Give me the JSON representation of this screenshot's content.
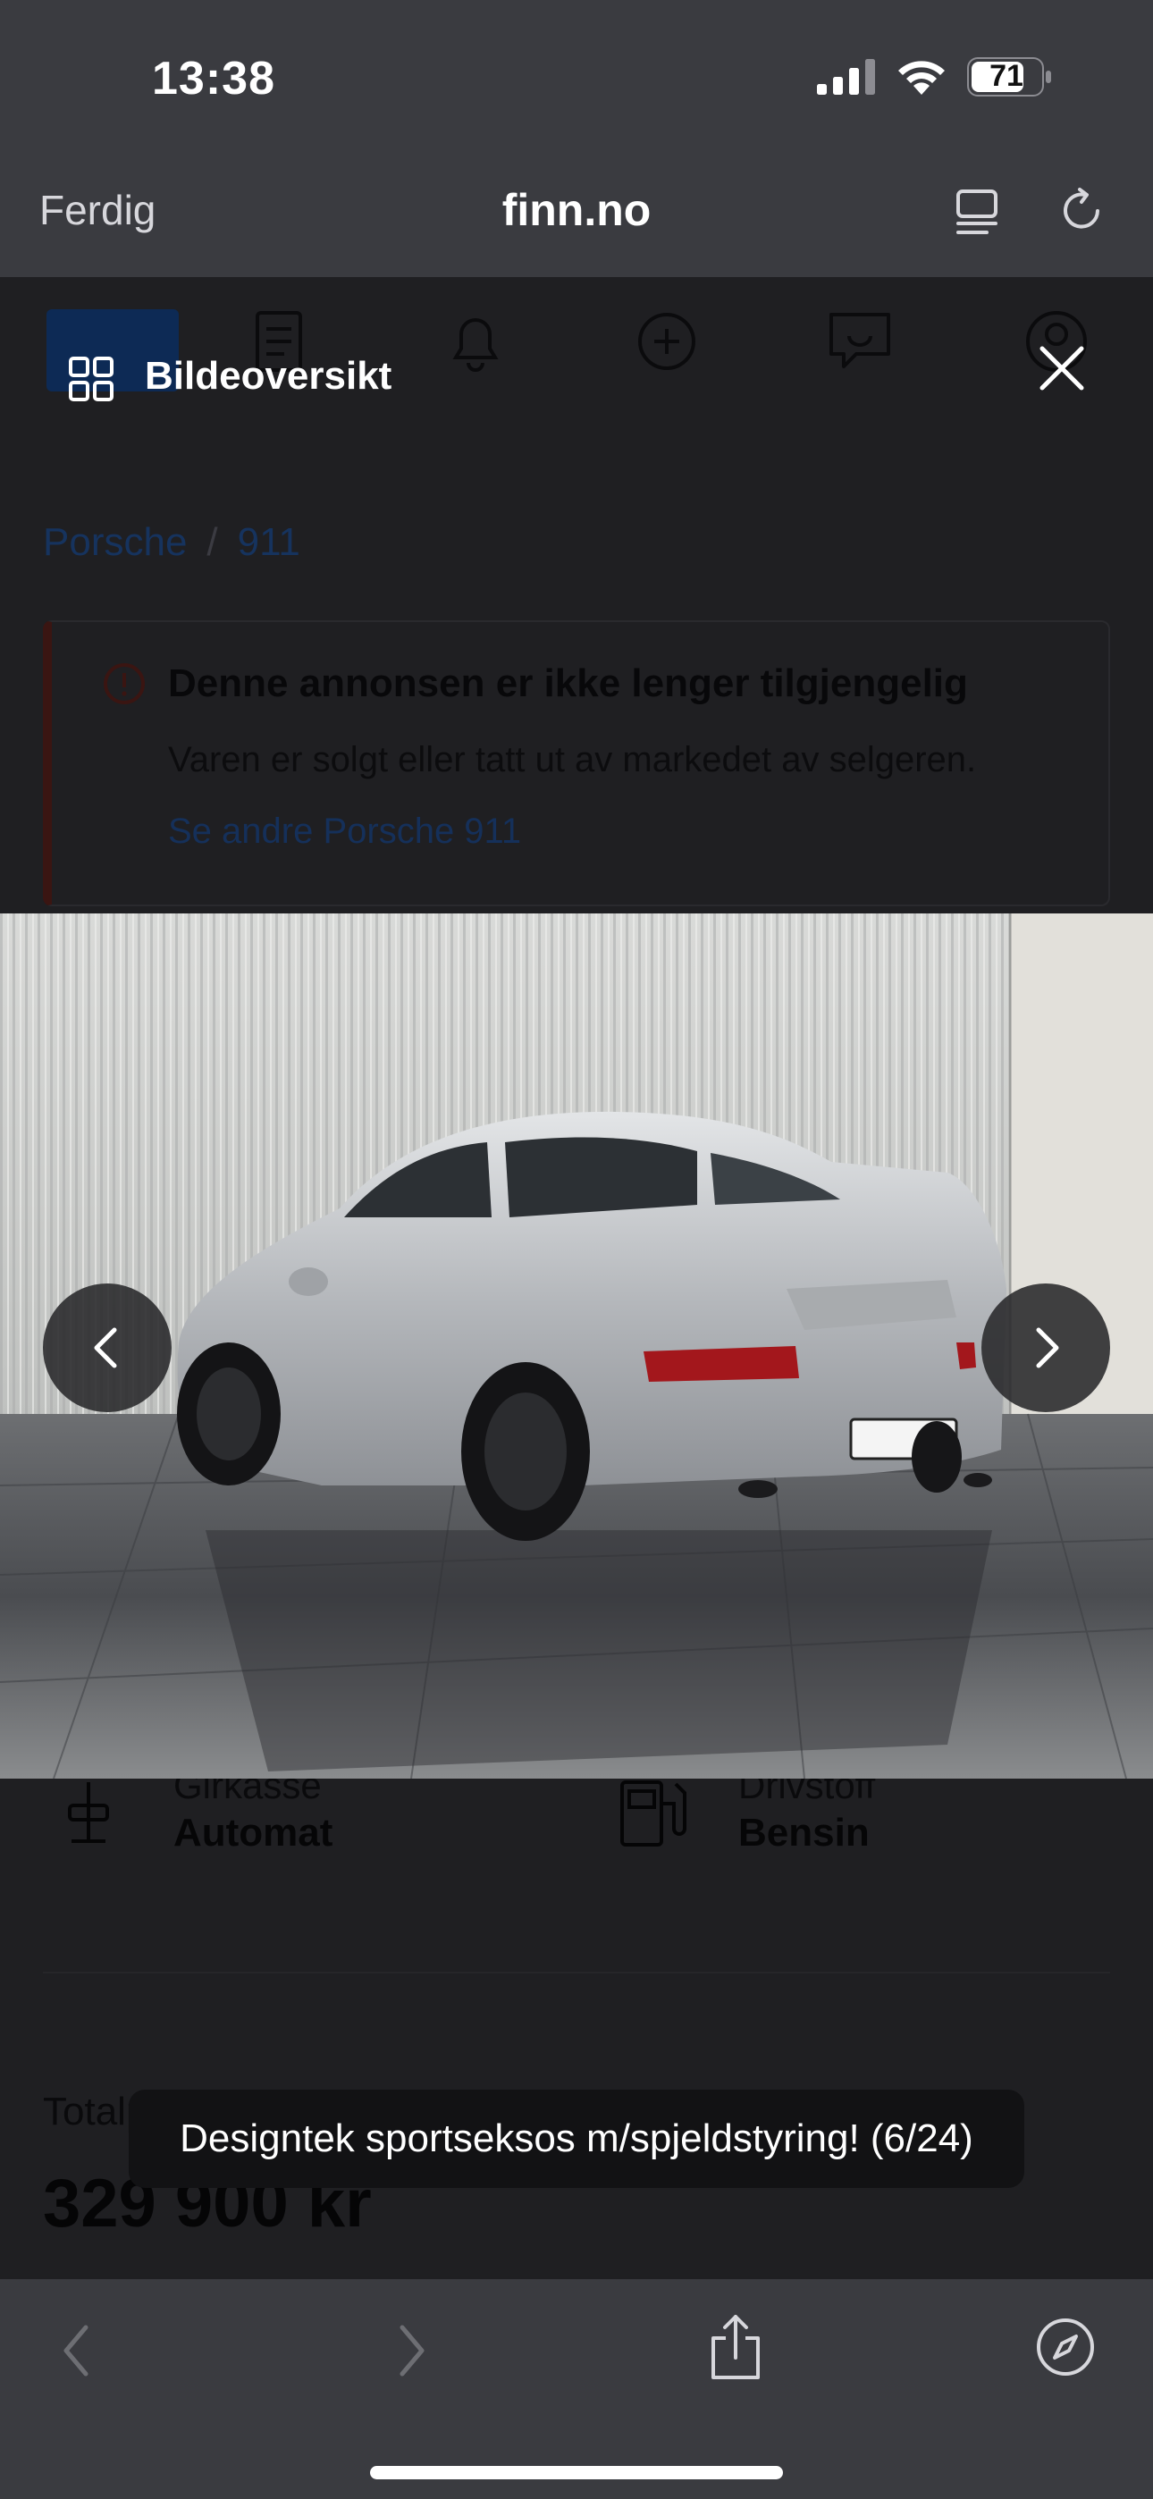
{
  "status_bar": {
    "time": "13:38",
    "battery_level": "71"
  },
  "browser": {
    "done_label": "Ferdig",
    "url": "finn.no"
  },
  "page": {
    "breadcrumb": [
      "Porsche",
      "911"
    ],
    "breadcrumb_separator": "/",
    "alert": {
      "title": "Denne annonsen er ikke lenger tilgjengelig",
      "text": "Varen er solgt eller tatt ut av markedet av selgeren.",
      "link": "Se andre Porsche 911"
    },
    "specs": [
      {
        "label": "Girkasse",
        "value": "Automat"
      },
      {
        "label": "Drivstoff",
        "value": "Bensin"
      }
    ],
    "total_label": "Totalpris",
    "price": "329 900 kr"
  },
  "gallery": {
    "overview_label": "Bildeoversikt",
    "caption": "Designtek sportseksos m/spjeldstyring! (6/24)"
  },
  "colors": {
    "chrome": "#3a3b40",
    "overlay": "#1f1f22",
    "caption_bg": "#121214"
  }
}
